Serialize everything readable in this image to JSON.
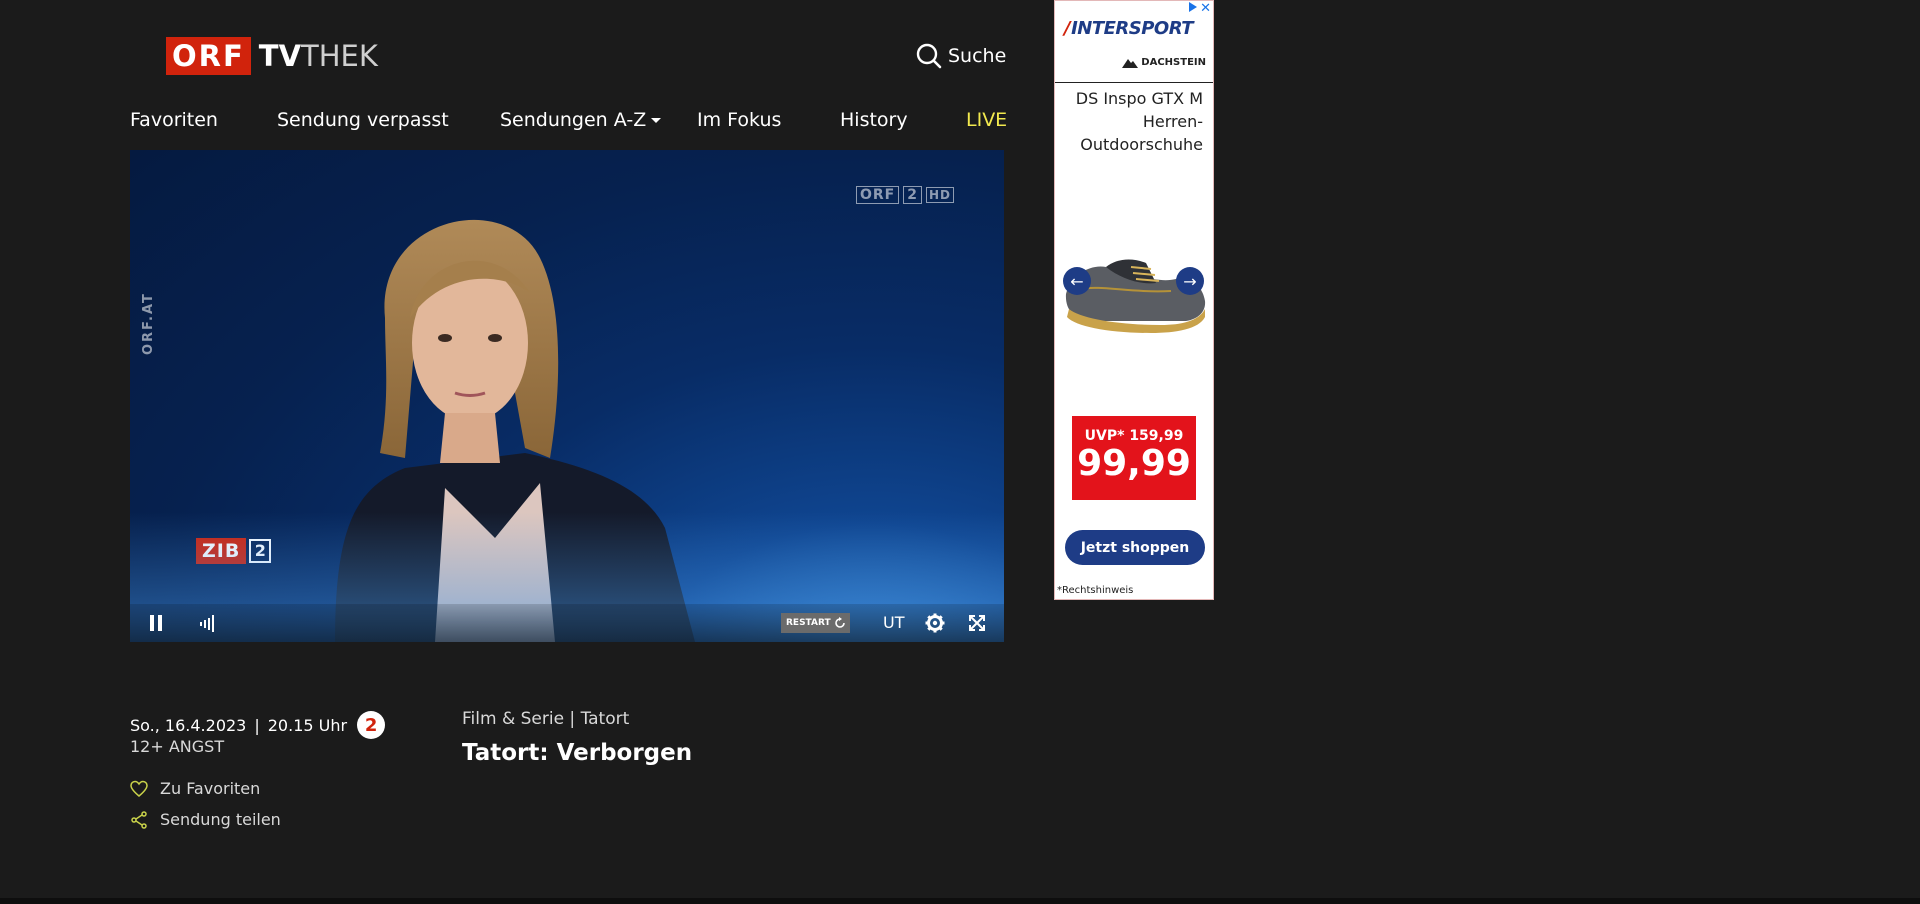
{
  "header": {
    "logo_orf": "ORF",
    "logo_tv": "TV",
    "logo_thek": "THEK",
    "search_label": "Suche"
  },
  "nav": {
    "items": [
      "Favoriten",
      "Sendung verpasst",
      "Sendungen A-Z",
      "Im Fokus",
      "History",
      "LIVE"
    ]
  },
  "player": {
    "watermark_channel": "ORF",
    "watermark_channel_num": "2",
    "watermark_hd": "HD",
    "side_watermark": "ORF.AT",
    "show_logo": "ZIB",
    "show_logo_num": "2",
    "restart_label": "RESTART",
    "subtitles_label": "UT"
  },
  "info": {
    "date": "So., 16.4.2023",
    "separator": "|",
    "time": "20.15 Uhr",
    "channel_num": "2",
    "age_rating": "12+ ANGST",
    "favorite_label": "Zu Favoriten",
    "share_label": "Sendung teilen",
    "category": "Film & Serie | Tatort",
    "title": "Tatort: Verborgen"
  },
  "ad": {
    "brand": "INTERSPORT",
    "brand_mark": "/",
    "sub_brand": "DACHSTEIN",
    "product": "DS Inspo GTX M Herren-Outdoorschuhe",
    "uvp": "UVP* 159,99",
    "price": "99,99",
    "cta": "Jetzt shoppen",
    "note": "*Rechtshinweis",
    "close": "✕",
    "arrow_prev": "←",
    "arrow_next": "→"
  },
  "colors": {
    "background": "#1b1b1b",
    "orf_red": "#d1230c",
    "live_yellow": "#f2e94e",
    "ad_blue": "#1e3c86",
    "ad_red": "#e3131b"
  }
}
